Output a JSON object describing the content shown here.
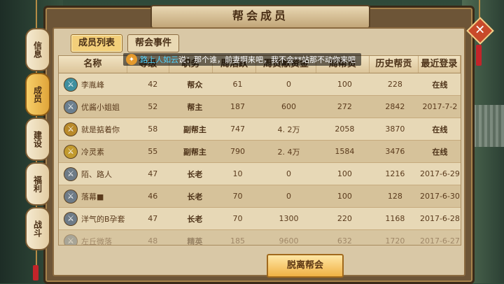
{
  "window": {
    "title": "帮会成员"
  },
  "tabs": [
    {
      "label": "成员列表",
      "active": true
    },
    {
      "label": "帮会事件",
      "active": false
    }
  ],
  "side_tabs": [
    {
      "label": "信息",
      "active": false
    },
    {
      "label": "成员",
      "active": true
    },
    {
      "label": "建设",
      "active": false
    },
    {
      "label": "福利",
      "active": false
    },
    {
      "label": "战斗",
      "active": false
    }
  ],
  "columns": [
    "名称",
    "等级",
    "职务",
    "周活跃",
    "周贡献资金",
    "周帮贡",
    "历史帮贡",
    "最近登录"
  ],
  "members": [
    {
      "name": "李胤峰",
      "level": "42",
      "role": "帮众",
      "weekly_activity": "61",
      "weekly_fund": "0",
      "weekly_contrib": "100",
      "history_contrib": "228",
      "last_login": "在线",
      "avatar_color": "#3f8f9f"
    },
    {
      "name": "优酱小姐姐",
      "level": "52",
      "role": "帮主",
      "weekly_activity": "187",
      "weekly_fund": "600",
      "weekly_contrib": "272",
      "history_contrib": "2842",
      "last_login": "2017-7-2",
      "avatar_color": "#6b7f8f"
    },
    {
      "name": "就是掂着你",
      "level": "58",
      "role": "副帮主",
      "weekly_activity": "747",
      "weekly_fund": "4. 2万",
      "weekly_contrib": "2058",
      "history_contrib": "3870",
      "last_login": "在线",
      "avatar_color": "#b98a2a"
    },
    {
      "name": "冷灵素",
      "level": "55",
      "role": "副帮主",
      "weekly_activity": "790",
      "weekly_fund": "2. 4万",
      "weekly_contrib": "1584",
      "history_contrib": "3476",
      "last_login": "在线",
      "avatar_color": "#c29a2e"
    },
    {
      "name": "陌、路人",
      "level": "47",
      "role": "长老",
      "weekly_activity": "10",
      "weekly_fund": "0",
      "weekly_contrib": "100",
      "history_contrib": "1216",
      "last_login": "2017-6-29",
      "avatar_color": "#6e7b87"
    },
    {
      "name": "落幕■",
      "level": "46",
      "role": "长老",
      "weekly_activity": "70",
      "weekly_fund": "0",
      "weekly_contrib": "100",
      "history_contrib": "128",
      "last_login": "2017-6-30",
      "avatar_color": "#6e7b87"
    },
    {
      "name": "洋气的B孕套",
      "level": "47",
      "role": "长老",
      "weekly_activity": "70",
      "weekly_fund": "1300",
      "weekly_contrib": "220",
      "history_contrib": "1168",
      "last_login": "2017-6-28",
      "avatar_color": "#6e7b87"
    },
    {
      "name": "左丘微落",
      "level": "48",
      "role": "精英",
      "weekly_activity": "185",
      "weekly_fund": "9600",
      "weekly_contrib": "632",
      "history_contrib": "1720",
      "last_login": "2017-6-27",
      "avatar_color": "#6e7b87"
    }
  ],
  "broadcast": {
    "name": "路上人如云",
    "message": "说：那个谁，前妻啊来吧，我不会**站那不动你来吧"
  },
  "leave_button": {
    "label": "脱离帮会"
  },
  "close_button": {
    "label": "✕"
  }
}
